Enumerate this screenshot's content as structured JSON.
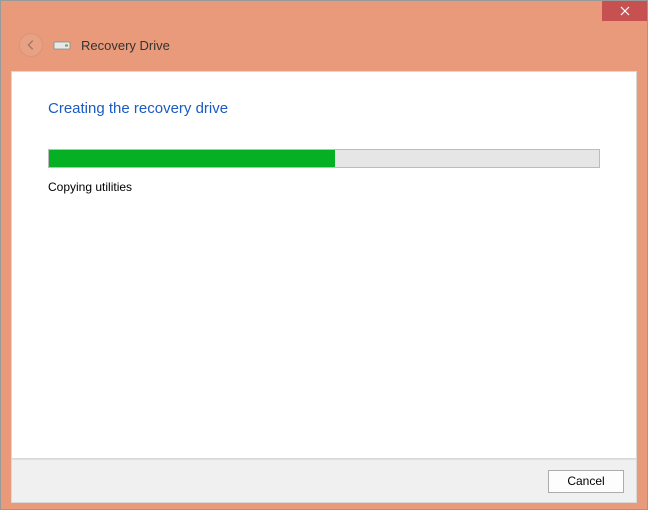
{
  "window": {
    "title": "Recovery Drive"
  },
  "content": {
    "heading": "Creating the recovery drive",
    "progress_percent": 52,
    "status": "Copying utilities"
  },
  "footer": {
    "cancel_label": "Cancel"
  },
  "colors": {
    "chrome": "#e89a7a",
    "close": "#c75050",
    "progress_fill": "#06b025",
    "heading": "#1b5bc2"
  }
}
